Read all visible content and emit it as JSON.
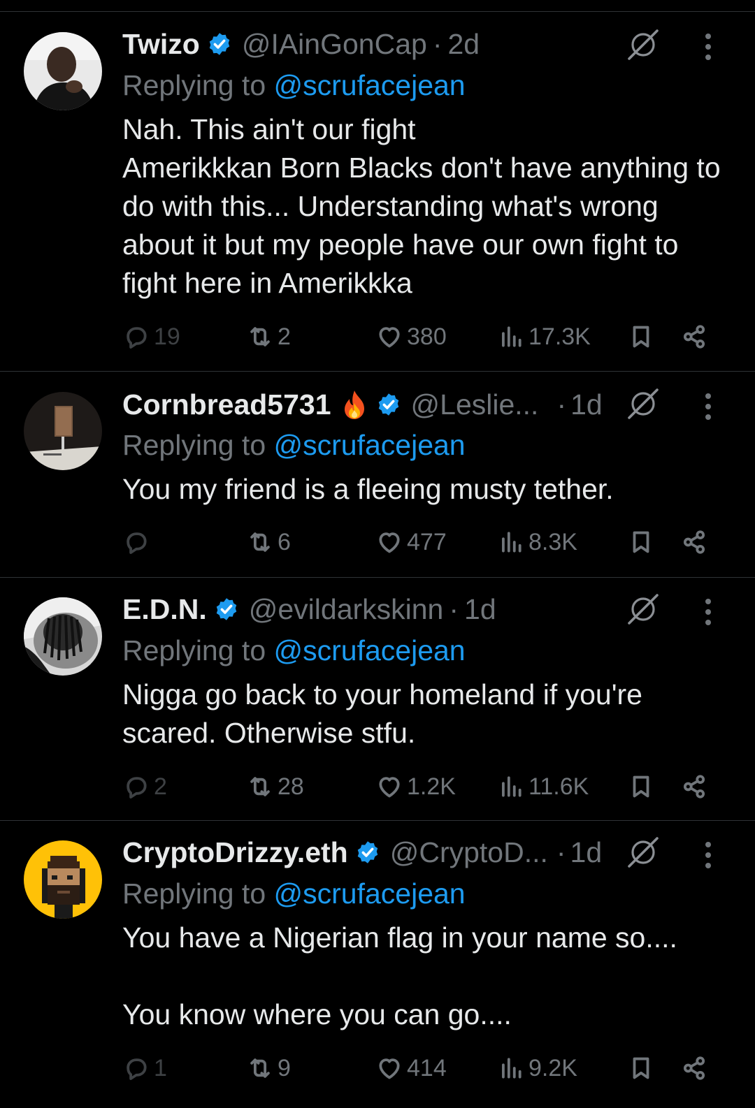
{
  "tweets": [
    {
      "name": "Twizo",
      "handle": "@IAinGonCap",
      "time": "2d",
      "replying_prefix": "Replying to ",
      "replying_to": "@scrufacejean",
      "text": "Nah. This ain't our fight\nAmerikkkan Born Blacks don't have anything to do with this... Understanding what's wrong about it but my people have our own fight to fight here in Amerikkka",
      "replies": "19",
      "reposts": "2",
      "likes": "380",
      "views": "17.3K"
    },
    {
      "name": "Cornbread5731",
      "emoji": "fire-emoji",
      "handle": "@Leslie...",
      "time": "1d",
      "replying_prefix": "Replying to ",
      "replying_to": "@scrufacejean",
      "text": "You my friend is a fleeing musty tether.",
      "replies": "",
      "reposts": "6",
      "likes": "477",
      "views": "8.3K"
    },
    {
      "name": "E.D.N.",
      "handle": "@evildarkskinn",
      "time": "1d",
      "replying_prefix": "Replying to ",
      "replying_to": "@scrufacejean",
      "text": "Nigga go back to your homeland if you're scared. Otherwise stfu.",
      "replies": "2",
      "reposts": "28",
      "likes": "1.2K",
      "views": "11.6K"
    },
    {
      "name": "CryptoDrizzy.eth",
      "handle": "@CryptoD...",
      "time": "1d",
      "replying_prefix": "Replying to ",
      "replying_to": "@scrufacejean",
      "text": "You have a Nigerian flag in your name so....\n\nYou know where you can go....",
      "replies": "1",
      "reposts": "9",
      "likes": "414",
      "views": "9.2K"
    }
  ],
  "separator": "·",
  "icons": {
    "verified": "verified-badge-icon",
    "grok": "grok-icon",
    "more": "more-options-icon",
    "reply": "reply-icon",
    "repost": "repost-icon",
    "like": "heart-icon",
    "views": "views-icon",
    "bookmark": "bookmark-icon",
    "share": "share-icon"
  },
  "colors": {
    "background": "#000000",
    "text": "#e7e9ea",
    "secondary": "#71767b",
    "link": "#1d9bf0",
    "verified": "#1d9bf0",
    "divider": "#2f3336"
  }
}
